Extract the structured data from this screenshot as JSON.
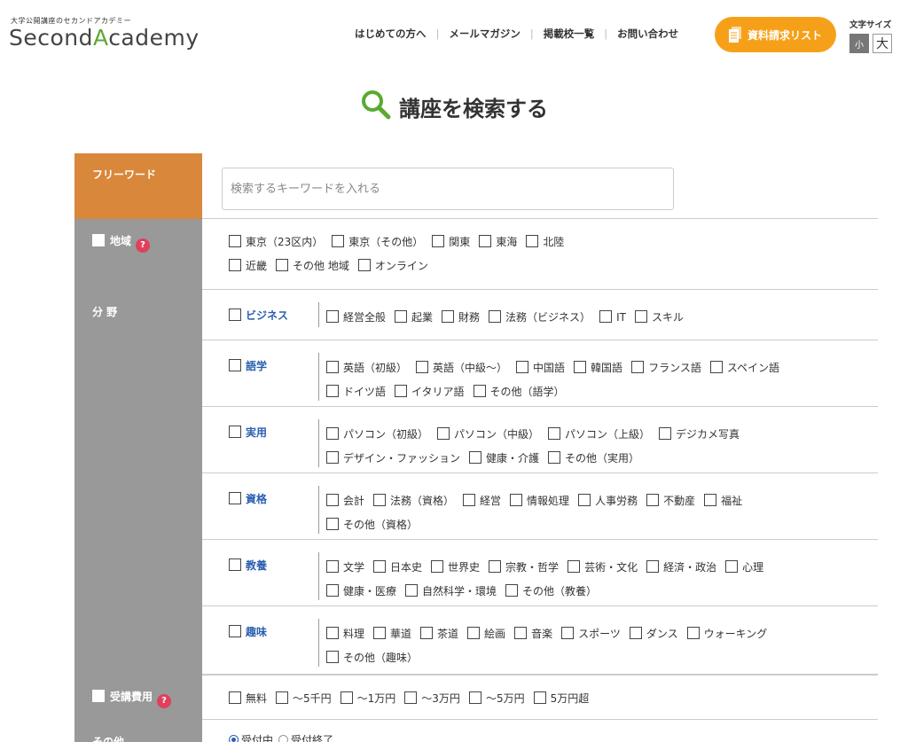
{
  "header": {
    "tagline": "大学公開講座のセカンドアカデミー",
    "logo_pre": "Second",
    "logo_accent": "A",
    "logo_post": "cademy",
    "nav": [
      "はじめての方へ",
      "メールマガジン",
      "掲載校一覧",
      "お問い合わせ"
    ],
    "doc_button": "資料請求リスト",
    "fontsize_label": "文字サイズ",
    "fontsize_small": "小",
    "fontsize_large": "大",
    "accent_color": "#f6a019"
  },
  "title": "講座を検索する",
  "freeword": {
    "label": "フリーワード",
    "placeholder": "検索するキーワードを入れる"
  },
  "region": {
    "label": "地域",
    "help": "?",
    "options": [
      "東京（23区内）",
      "東京（その他）",
      "関東",
      "東海",
      "北陸",
      "近畿",
      "その他 地域",
      "オンライン"
    ]
  },
  "field": {
    "label": "分 野",
    "categories": [
      {
        "name": "ビジネス",
        "options": [
          "経営全般",
          "起業",
          "財務",
          "法務（ビジネス）",
          "IT",
          "スキル"
        ]
      },
      {
        "name": "語学",
        "options": [
          "英語（初級）",
          "英語（中級〜）",
          "中国語",
          "韓国語",
          "フランス語",
          "スペイン語",
          "ドイツ語",
          "イタリア語",
          "その他（語学）"
        ]
      },
      {
        "name": "実用",
        "options": [
          "パソコン（初級）",
          "パソコン（中級）",
          "パソコン（上級）",
          "デジカメ写真",
          "デザイン・ファッション",
          "健康・介護",
          "その他（実用）"
        ]
      },
      {
        "name": "資格",
        "options": [
          "会計",
          "法務（資格）",
          "経営",
          "情報処理",
          "人事労務",
          "不動産",
          "福祉",
          "その他（資格）"
        ]
      },
      {
        "name": "教養",
        "options": [
          "文学",
          "日本史",
          "世界史",
          "宗教・哲学",
          "芸術・文化",
          "経済・政治",
          "心理",
          "健康・医療",
          "自然科学・環境",
          "その他（教養）"
        ]
      },
      {
        "name": "趣味",
        "options": [
          "料理",
          "華道",
          "茶道",
          "絵画",
          "音楽",
          "スポーツ",
          "ダンス",
          "ウォーキング",
          "その他（趣味）"
        ]
      }
    ]
  },
  "fee": {
    "label": "受講費用",
    "help": "?",
    "options": [
      "無料",
      "〜5千円",
      "〜1万円",
      "〜3万円",
      "〜5万円",
      "5万円超"
    ]
  },
  "other": {
    "label": "その他",
    "radios": [
      {
        "label": "受付中",
        "checked": true
      },
      {
        "label": "受付終了",
        "checked": false
      }
    ]
  }
}
